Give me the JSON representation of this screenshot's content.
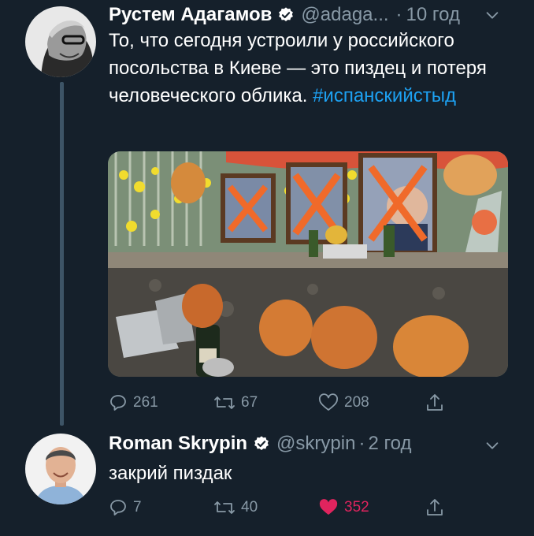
{
  "tweet1": {
    "name": "Рустем Адагамов",
    "handle": "@adaga...",
    "dot": "·",
    "time": "10 год",
    "text_main": "То, что сегодня устроили у российского посольства в Киеве — это пиздец и потеря человеческого облика.",
    "hashtag": "#испанскийстыд",
    "replies": "261",
    "retweets": "67",
    "likes": "208"
  },
  "tweet2": {
    "name": "Roman Skrypin",
    "handle": "@skrypin",
    "dot": "·",
    "time": "2 год",
    "text": "закрий пиздак",
    "replies": "7",
    "retweets": "40",
    "likes": "352"
  },
  "colors": {
    "background": "#15202b",
    "secondary_text": "#8899a6",
    "link": "#1da1f2",
    "liked": "#e0245e",
    "thread_line": "#3d5466"
  },
  "icons": [
    "verified-badge-icon",
    "chevron-down-icon",
    "reply-icon",
    "retweet-icon",
    "like-icon",
    "share-icon"
  ]
}
